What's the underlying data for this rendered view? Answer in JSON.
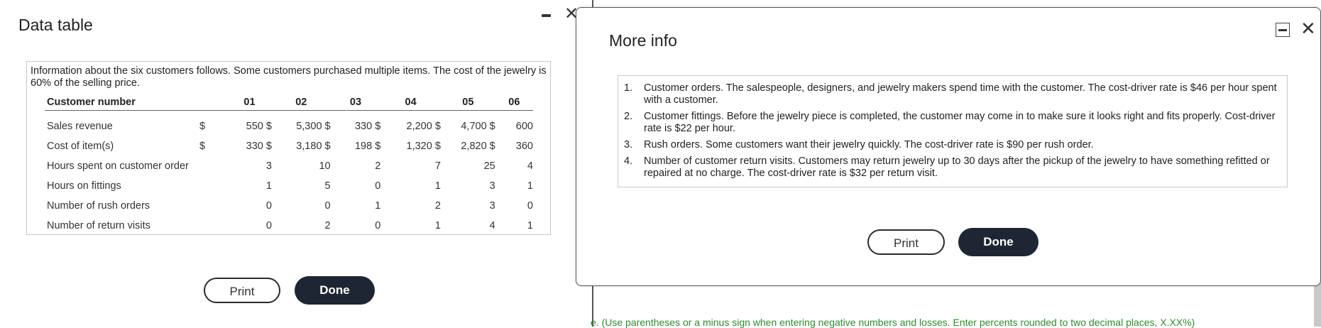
{
  "data_table_dialog": {
    "title": "Data table",
    "intro": "Information about the six customers follows. Some customers purchased multiple items. The cost of the jewelry is 60% of the selling price.",
    "header": {
      "label": "Customer number",
      "columns": [
        "01",
        "02",
        "03",
        "04",
        "05",
        "06"
      ]
    },
    "rows": [
      {
        "label": "Sales revenue",
        "currency": "$",
        "values": [
          "550 $",
          "5,300 $",
          "330 $",
          "2,200 $",
          "4,700 $",
          "600"
        ]
      },
      {
        "label": "Cost of item(s)",
        "currency": "$",
        "values": [
          "330 $",
          "3,180 $",
          "198 $",
          "1,320 $",
          "2,820 $",
          "360"
        ]
      },
      {
        "label": "Hours spent on customer order",
        "currency": "",
        "values": [
          "3",
          "10",
          "2",
          "7",
          "25",
          "4"
        ]
      },
      {
        "label": "Hours on fittings",
        "currency": "",
        "values": [
          "1",
          "5",
          "0",
          "1",
          "3",
          "1"
        ]
      },
      {
        "label": "Number of rush orders",
        "currency": "",
        "values": [
          "0",
          "0",
          "1",
          "2",
          "3",
          "0"
        ]
      },
      {
        "label": "Number of return visits",
        "currency": "",
        "values": [
          "0",
          "2",
          "0",
          "1",
          "4",
          "1"
        ]
      }
    ],
    "print_label": "Print",
    "done_label": "Done",
    "close_glyph": "✕"
  },
  "more_info_dialog": {
    "title": "More info",
    "items": [
      {
        "num": "1.",
        "text": "Customer orders. The salespeople, designers, and jewelry makers spend time with the customer. The cost-driver rate is $46 per hour spent with a customer."
      },
      {
        "num": "2.",
        "text": "Customer fittings. Before the jewelry piece is completed, the customer may come in to make sure it looks right and fits properly. Cost-driver rate is $22 per hour."
      },
      {
        "num": "3.",
        "text": "Rush orders. Some customers want their jewelry quickly. The cost-driver rate is $90 per rush order."
      },
      {
        "num": "4.",
        "text": "Number of customer return visits. Customers may return jewelry up to 30 days after the pickup of the jewelry to have something refitted or repaired at no charge. The cost-driver rate is $32 per return visit."
      }
    ],
    "print_label": "Print",
    "done_label": "Done",
    "close_glyph": "✕"
  },
  "background_page": {
    "hint": "e. (Use parentheses or a minus sign when entering negative numbers and losses. Enter percents rounded to two decimal places, X.XX%)"
  },
  "colors": {
    "dark_button": "#1e2633",
    "hint_text": "#2e8b2e",
    "border": "#c8c8c8"
  }
}
